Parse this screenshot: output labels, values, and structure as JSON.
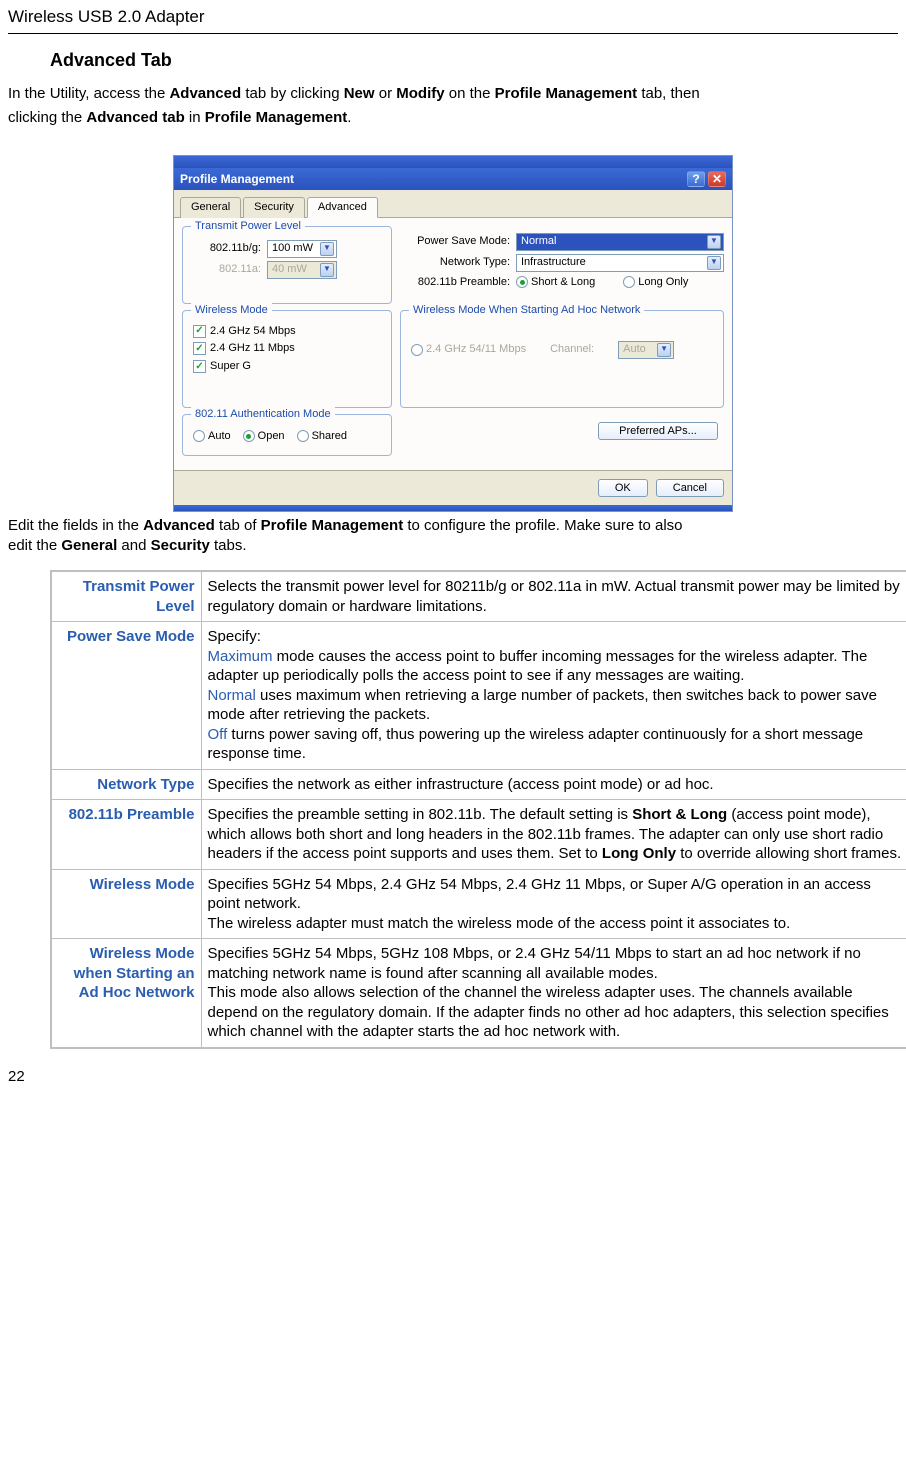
{
  "header": {
    "title": "Wireless USB 2.0 Adapter"
  },
  "section": {
    "title": "Advanced Tab"
  },
  "intro": {
    "line1_a": "In the Utility, access the ",
    "line1_b": "Advanced",
    "line1_c": " tab by clicking ",
    "line1_d": "New",
    "line1_e": " or ",
    "line1_f": "Modify",
    "line1_g": " on the ",
    "line1_h": "Profile Management",
    "line1_i": " tab, then",
    "line2_a": "clicking the ",
    "line2_b": "Advanced tab",
    "line2_c": " in ",
    "line2_d": "Profile Management",
    "line2_e": "."
  },
  "screenshot": {
    "window_title": "Profile Management",
    "help_btn": "?",
    "close_btn": "✕",
    "tabs": {
      "general": "General",
      "security": "Security",
      "advanced": "Advanced"
    },
    "tpl": {
      "legend": "Transmit Power Level",
      "bg_label": "802.11b/g:",
      "bg_value": "100 mW",
      "a_label": "802.11a:",
      "a_value": "40 mW"
    },
    "right": {
      "psm_label": "Power Save Mode:",
      "psm_value": "Normal",
      "nt_label": "Network Type:",
      "nt_value": "Infrastructure",
      "preamble_label": "802.11b Preamble:",
      "preamble_short_long": "Short & Long",
      "preamble_long_only": "Long Only"
    },
    "wm": {
      "legend": "Wireless Mode",
      "c1": "2.4 GHz 54 Mbps",
      "c2": "2.4 GHz 11 Mbps",
      "c3": "Super G"
    },
    "wmah": {
      "legend": "Wireless Mode When Starting Ad Hoc Network",
      "opt": "2.4 GHz 54/11 Mbps",
      "channel_label": "Channel:",
      "channel_value": "Auto"
    },
    "auth": {
      "legend": "802.11 Authentication Mode",
      "auto": "Auto",
      "open": "Open",
      "shared": "Shared"
    },
    "pref_btn": "Preferred APs...",
    "ok": "OK",
    "cancel": "Cancel"
  },
  "post_img": {
    "a": "Edit the fields in the ",
    "b": "Advanced",
    "c": " tab of ",
    "d": "Profile Management",
    "e": " to configure the profile. Make sure to also",
    "f": "edit the ",
    "g": "General",
    "h": " and ",
    "i": "Security",
    "j": " tabs."
  },
  "table": {
    "rows": [
      {
        "term": "Transmit Power Level",
        "desc": [
          {
            "t": "Selects the transmit power level for 80211b/g or 802.11a in mW. Actual transmit power may be limited by regulatory domain or hardware limitations."
          }
        ]
      },
      {
        "term": "Power Save Mode",
        "desc": [
          {
            "t": "Specify:"
          },
          {
            "blue": "Maximum",
            "t": " mode causes the access point to buffer incoming messages for the wireless adapter. The adapter up periodically polls the access point to see if any messages are waiting."
          },
          {
            "blue": "Normal",
            "t": " uses maximum when retrieving a large number of packets, then switches back to power save mode after retrieving the packets."
          },
          {
            "blue": "Off",
            "t": " turns power saving off, thus powering up the wireless adapter continuously for a short message response time."
          }
        ]
      },
      {
        "term": "Network Type",
        "desc": [
          {
            "t": "Specifies the network as either infrastructure (access point mode) or ad hoc."
          }
        ]
      },
      {
        "term": "802.11b Preamble",
        "desc": [
          {
            "t": "Specifies the preamble setting in 802.11b. The default setting is ",
            "bold_after": "Short & Long",
            "t2": " (access point mode), which allows both short and long headers in the 802.11b frames. The adapter can only use short radio headers if the access point supports and uses them. Set to ",
            "bold_after2": "Long Only",
            "t3": " to override allowing short frames."
          }
        ]
      },
      {
        "term": "Wireless Mode",
        "desc": [
          {
            "t": "Specifies 5GHz 54 Mbps, 2.4 GHz 54 Mbps, 2.4 GHz 11 Mbps, or Super A/G operation in an access point network."
          },
          {
            "t": "The wireless adapter must match the wireless mode of the access point it associates to."
          }
        ]
      },
      {
        "term": "Wireless Mode when Starting an Ad Hoc Network",
        "desc": [
          {
            "t": "Specifies 5GHz 54 Mbps, 5GHz 108 Mbps, or 2.4 GHz 54/11 Mbps to start an ad hoc network if no matching network name is found after scanning all available modes."
          },
          {
            "t": "This mode also allows selection of the channel the wireless adapter uses. The channels available depend on the regulatory domain. If the adapter finds no other ad hoc adapters, this selection specifies which channel with the adapter starts the ad hoc network with."
          }
        ]
      }
    ]
  },
  "page_num": "22"
}
